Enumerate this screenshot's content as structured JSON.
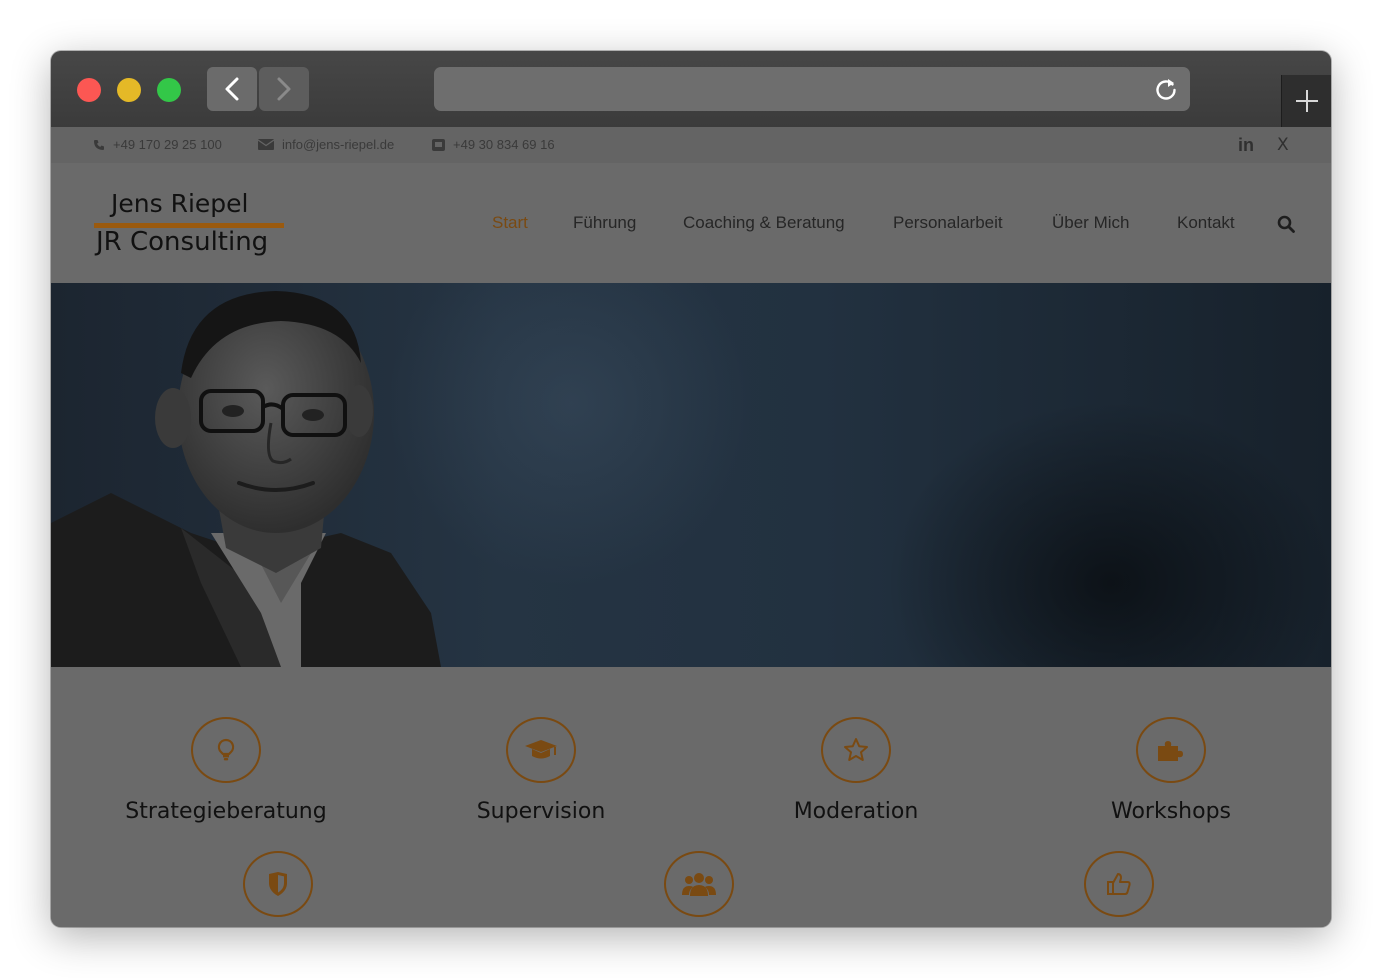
{
  "browser": {
    "back_icon": "chevron-left-icon",
    "forward_icon": "chevron-right-icon",
    "reload_icon": "reload-icon",
    "new_tab_icon": "plus-icon",
    "url": ""
  },
  "topbar": {
    "phone": "+49 170 29 25 100",
    "email": "info@jens-riepel.de",
    "fax": "+49 30 834 69 16",
    "social": [
      "in",
      "X"
    ]
  },
  "logo": {
    "line1": "Jens Riepel",
    "line2": "JR Consulting"
  },
  "nav": {
    "items": [
      "Start",
      "Führung",
      "Coaching & Beratung",
      "Personalarbeit",
      "Über Mich",
      "Kontakt"
    ],
    "active": "Start"
  },
  "features": {
    "row1": [
      {
        "label": "Strategieberatung",
        "icon": "lightbulb-icon"
      },
      {
        "label": "Supervision",
        "icon": "graduation-cap-icon"
      },
      {
        "label": "Moderation",
        "icon": "star-icon"
      },
      {
        "label": "Workshops",
        "icon": "puzzle-icon"
      }
    ],
    "row2": [
      {
        "icon": "shield-icon"
      },
      {
        "icon": "users-icon"
      },
      {
        "icon": "thumbs-up-icon"
      }
    ]
  },
  "colors": {
    "accent": "#7a4a12",
    "overlay_bg": "#6a6a6a"
  }
}
